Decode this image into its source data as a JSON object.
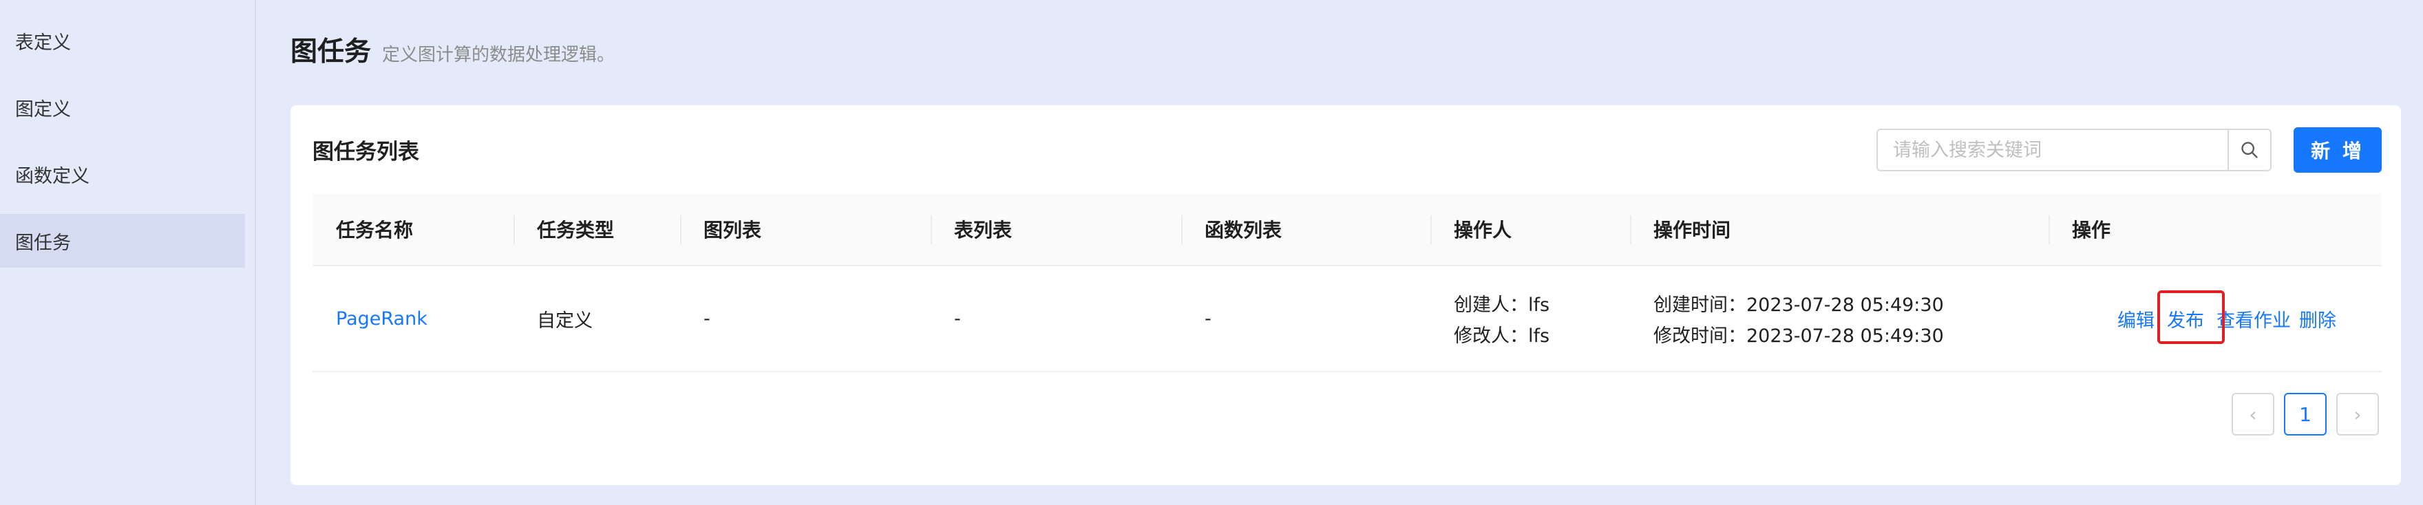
{
  "sidebar": {
    "items": [
      {
        "label": "表定义"
      },
      {
        "label": "图定义"
      },
      {
        "label": "函数定义"
      },
      {
        "label": "图任务"
      }
    ]
  },
  "header": {
    "title": "图任务",
    "subtitle": "定义图计算的数据处理逻辑。"
  },
  "card": {
    "title": "图任务列表",
    "search_placeholder": "请输入搜索关键词",
    "add_label": "新 增"
  },
  "table": {
    "columns": [
      "任务名称",
      "任务类型",
      "图列表",
      "表列表",
      "函数列表",
      "操作人",
      "操作时间",
      "操作"
    ],
    "rows": [
      {
        "name": "PageRank",
        "type": "自定义",
        "graphs": "-",
        "tables": "-",
        "functions": "-",
        "creator": "创建人：lfs",
        "modifier": "修改人：lfs",
        "created": "创建时间：2023-07-28 05:49:30",
        "modified": "修改时间：2023-07-28 05:49:30",
        "ops": {
          "edit": "编辑",
          "publish": "发布",
          "view": "查看作业",
          "delete": "删除"
        }
      }
    ]
  },
  "pagination": {
    "prev": "‹",
    "current": "1",
    "next": "›"
  },
  "colors": {
    "accent": "#1677ff",
    "highlight": "#e02020",
    "background": "#e4eaf9"
  }
}
